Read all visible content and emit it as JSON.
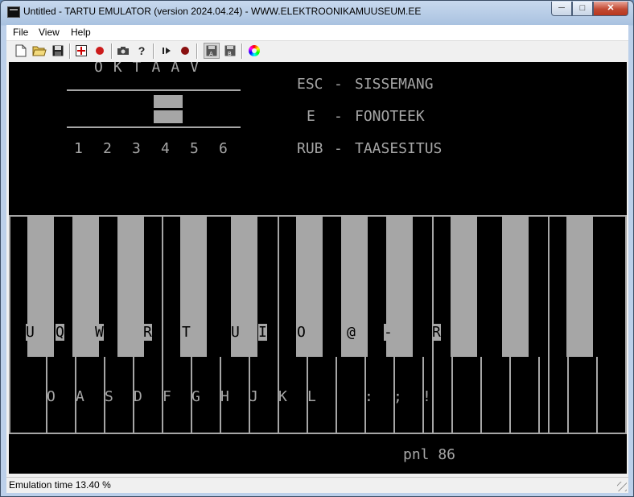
{
  "window": {
    "title": "Untitled - TARTU EMULATOR (version 2024.04.24) - WWW.ELEKTROONIKAMUUSEUM.EE"
  },
  "menu": [
    "File",
    "View",
    "Help"
  ],
  "toolbar": [
    "new-icon",
    "open-icon",
    "save-icon",
    "crosshair-icon",
    "record-icon",
    "camera-icon",
    "help-icon",
    "play-icon",
    "stop-icon",
    "disk-a-icon",
    "disk-b-icon",
    "color-wheel-icon"
  ],
  "screen": {
    "octave_title": "OKTAAV",
    "octave_numbers": [
      "1",
      "2",
      "3",
      "4",
      "5",
      "6"
    ],
    "commands": [
      {
        "key": "ESC",
        "label": "SISSEMANG"
      },
      {
        "key": "E",
        "label": "FONOTEEK"
      },
      {
        "key": "RUB",
        "label": "TAASESITUS"
      }
    ],
    "upper_keys": [
      "U",
      "Q",
      "W",
      "R",
      "T",
      "U",
      "I",
      "O",
      "@",
      "-",
      "R"
    ],
    "lower_keys": [
      "O",
      "A",
      "S",
      "D",
      "F",
      "G",
      "H",
      "J",
      "K",
      "L",
      ":",
      ";",
      "!"
    ],
    "footer": "pnl 86"
  },
  "status": {
    "text": "Emulation time 13.40 %"
  },
  "colors": {
    "screen_bg": "#000000",
    "screen_fg": "#a6a6a6",
    "record_red": "#cc1b1b"
  }
}
